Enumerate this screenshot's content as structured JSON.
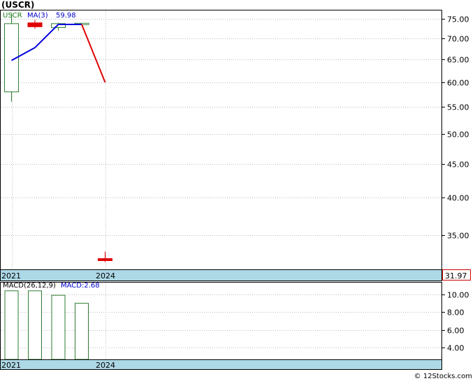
{
  "title": "(USCR)",
  "footer": "© 12Stocks.com",
  "colors": {
    "up": "#2e7d32",
    "down": "#e00000",
    "ma": "#0000dd",
    "xbar": "#add8e6",
    "label_green": "#1b7a1b",
    "label_blue": "#0000cc"
  },
  "chart_data": [
    {
      "type": "candlestick",
      "legend": {
        "symbol": "USCR",
        "ma_label": "MA(3)",
        "ma_value": "59.98"
      },
      "scale": "log",
      "ylim": [
        31.0,
        77.5
      ],
      "yticks": [
        35.0,
        40.0,
        45.0,
        50.0,
        55.0,
        60.0,
        65.0,
        70.0,
        75.0
      ],
      "ytick_labels": [
        "35.00",
        "40.00",
        "45.00",
        "50.00",
        "55.00",
        "60.00",
        "65.00",
        "70.00",
        "75.00"
      ],
      "x_labels": [
        {
          "i": 0,
          "text": "2021"
        },
        {
          "i": 4,
          "text": "2024"
        }
      ],
      "last_price_label": "31.97",
      "candles": [
        {
          "i": 0,
          "open": 58.0,
          "high": 76.5,
          "low": 56.0,
          "close": 73.8
        },
        {
          "i": 1,
          "open": 74.0,
          "high": 74.8,
          "low": 72.5,
          "close": 73.0
        },
        {
          "i": 2,
          "open": 72.8,
          "high": 74.0,
          "low": 72.0,
          "close": 73.8
        },
        {
          "i": 3,
          "open": 73.8,
          "high": 74.0,
          "low": 73.6,
          "close": 73.9
        },
        {
          "i": 4,
          "open": 32.2,
          "high": 33.0,
          "low": 31.8,
          "close": 31.97
        }
      ],
      "ma": [
        {
          "i": 0,
          "v": 64.8
        },
        {
          "i": 1,
          "v": 67.8
        },
        {
          "i": 2,
          "v": 73.6
        },
        {
          "i": 3,
          "v": 73.6
        },
        {
          "i": 4,
          "v": 59.98
        }
      ]
    },
    {
      "type": "bar",
      "legend": {
        "name": "MACD(26,12,9)",
        "value_label": "MACD:2.68"
      },
      "ylim": [
        2.7,
        11.4
      ],
      "yticks": [
        4.0,
        6.0,
        8.0,
        10.0
      ],
      "ytick_labels": [
        "4.00",
        "6.00",
        "8.00",
        "10.00"
      ],
      "x_labels": [
        {
          "i": 0,
          "text": "2021"
        },
        {
          "i": 4,
          "text": "2024"
        }
      ],
      "bars": [
        {
          "i": 0,
          "v": 10.4
        },
        {
          "i": 1,
          "v": 10.4
        },
        {
          "i": 2,
          "v": 9.9
        },
        {
          "i": 3,
          "v": 9.0
        }
      ]
    }
  ]
}
